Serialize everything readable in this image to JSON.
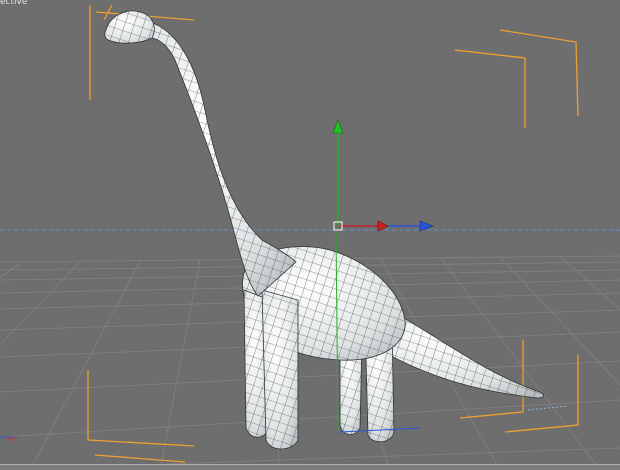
{
  "viewport": {
    "name_label": "ective",
    "colors": {
      "background": "#6e6e6e",
      "grid": "#808080",
      "horizon": "#5d8fd6",
      "selection_brackets": "#f0a030",
      "axis_x": "#2a55d8",
      "axis_y": "#22b022",
      "axis_z": "#cc2222",
      "wireframe": "#2f3436",
      "mesh_fill": "#eceeee"
    },
    "icons": [
      "move-gizmo-icon",
      "world-axis-icon"
    ]
  }
}
